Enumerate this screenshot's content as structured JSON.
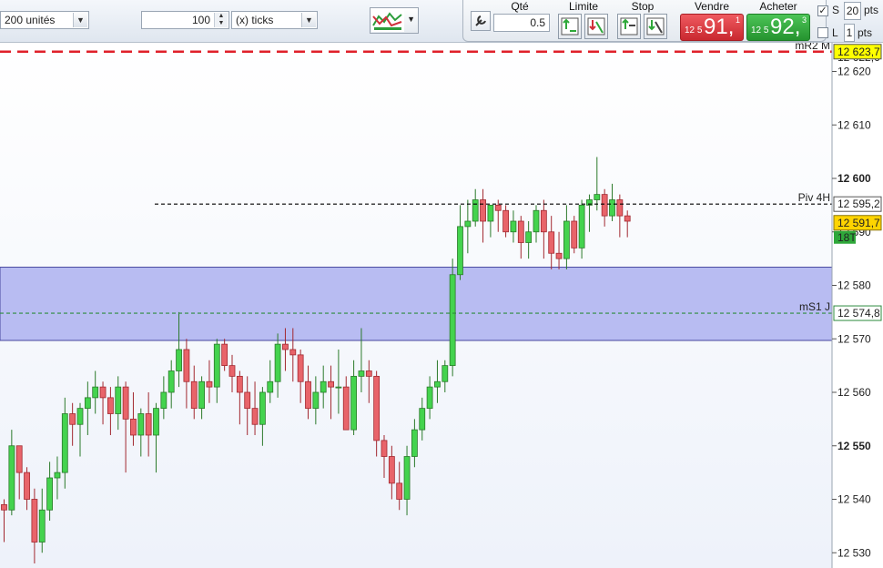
{
  "toolbar": {
    "units_select": "200 unités",
    "ticks_value": "100",
    "ticks_unit": "(x) ticks",
    "qty_label": "Qté",
    "qty_value": "0.5",
    "limit_label": "Limite",
    "stop_label": "Stop",
    "sell_label": "Vendre",
    "buy_label": "Acheter",
    "sell_price_prefix": "12 5",
    "sell_price_main": "91,",
    "sell_price_sup": "1",
    "buy_price_prefix": "12 5",
    "buy_price_main": "92,",
    "buy_price_sup": "3",
    "stop_s_label": "S",
    "stop_s_value": "20",
    "stop_s_unit": "pts",
    "limit_l_label": "L",
    "limit_l_value": "1",
    "limit_l_unit": "pts",
    "sell_color": "#e0444c",
    "buy_color": "#2fa83a"
  },
  "chart_data": {
    "type": "candlestick",
    "ylim": [
      12528,
      12624
    ],
    "y_ticks": [
      "12 530",
      "12 540",
      "12 550",
      "12 560",
      "12 570",
      "12 580",
      "12 590",
      "12 600",
      "12 610",
      "12 620"
    ],
    "zone": {
      "low": 12569.7,
      "high": 12583.4,
      "color": "#b8bcf2"
    },
    "lines": [
      {
        "name": "mR2 M",
        "value": 12623.7,
        "label": "12 623,7",
        "color": "#e0202a",
        "style": "dashed"
      },
      {
        "name": "Piv 4H",
        "value": 12595.2,
        "label": "12 595,2",
        "color": "#000000",
        "style": "dotted"
      },
      {
        "name": "mS1 J",
        "value": 12574.8,
        "label": "12 574,8",
        "color": "#2e8b3e",
        "style": "dashed"
      }
    ],
    "hidden_label": "12 622,6",
    "current_price": {
      "value": 12591.7,
      "label": "12 591,7"
    },
    "timer_label": "18T",
    "candles": [
      [
        12539,
        12540,
        12532,
        12538
      ],
      [
        12538,
        12553,
        12537,
        12550
      ],
      [
        12550,
        12549,
        12540,
        12545
      ],
      [
        12545,
        12546,
        12538,
        12540
      ],
      [
        12540,
        12542,
        12528,
        12532
      ],
      [
        12532,
        12542,
        12530,
        12538
      ],
      [
        12538,
        12547,
        12536,
        12544
      ],
      [
        12544,
        12548,
        12540,
        12545
      ],
      [
        12545,
        12559,
        12542,
        12556
      ],
      [
        12556,
        12558,
        12550,
        12554
      ],
      [
        12554,
        12558,
        12548,
        12557
      ],
      [
        12557,
        12562,
        12552,
        12559
      ],
      [
        12559,
        12564,
        12556,
        12561
      ],
      [
        12561,
        12562,
        12554,
        12559
      ],
      [
        12559,
        12561,
        12552,
        12556
      ],
      [
        12556,
        12563,
        12553,
        12561
      ],
      [
        12561,
        12562,
        12545,
        12555
      ],
      [
        12555,
        12560,
        12550,
        12552
      ],
      [
        12552,
        12557,
        12548,
        12556
      ],
      [
        12556,
        12560,
        12548,
        12552
      ],
      [
        12552,
        12558,
        12545,
        12557
      ],
      [
        12557,
        12563,
        12555,
        12560
      ],
      [
        12560,
        12566,
        12557,
        12564
      ],
      [
        12564,
        12575,
        12561,
        12568
      ],
      [
        12568,
        12570,
        12557,
        12562
      ],
      [
        12562,
        12565,
        12555,
        12557
      ],
      [
        12557,
        12563,
        12555,
        12562
      ],
      [
        12562,
        12566,
        12558,
        12561
      ],
      [
        12561,
        12570,
        12558,
        12569
      ],
      [
        12569,
        12570,
        12564,
        12565
      ],
      [
        12565,
        12567,
        12560,
        12563
      ],
      [
        12563,
        12564,
        12554,
        12560
      ],
      [
        12560,
        12563,
        12552,
        12557
      ],
      [
        12557,
        12562,
        12552,
        12554
      ],
      [
        12554,
        12561,
        12550,
        12560
      ],
      [
        12560,
        12566,
        12558,
        12562
      ],
      [
        12562,
        12571,
        12559,
        12569
      ],
      [
        12569,
        12572,
        12564,
        12568
      ],
      [
        12568,
        12572,
        12562,
        12567
      ],
      [
        12567,
        12568,
        12558,
        12562
      ],
      [
        12562,
        12565,
        12555,
        12557
      ],
      [
        12557,
        12563,
        12554,
        12560
      ],
      [
        12560,
        12565,
        12557,
        12562
      ],
      [
        12562,
        12565,
        12555,
        12561
      ],
      [
        12561,
        12568,
        12556,
        12561
      ],
      [
        12561,
        12563,
        12553,
        12553
      ],
      [
        12553,
        12566,
        12552,
        12563
      ],
      [
        12563,
        12572,
        12560,
        12564
      ],
      [
        12564,
        12566,
        12558,
        12563
      ],
      [
        12563,
        12564,
        12548,
        12551
      ],
      [
        12551,
        12552,
        12544,
        12548
      ],
      [
        12548,
        12550,
        12540,
        12543
      ],
      [
        12543,
        12547,
        12538,
        12540
      ],
      [
        12540,
        12550,
        12537,
        12548
      ],
      [
        12548,
        12555,
        12546,
        12553
      ],
      [
        12553,
        12559,
        12551,
        12557
      ],
      [
        12557,
        12563,
        12555,
        12561
      ],
      [
        12561,
        12566,
        12558,
        12562
      ],
      [
        12562,
        12566,
        12560,
        12565
      ],
      [
        12565,
        12585,
        12563,
        12582
      ],
      [
        12582,
        12595,
        12581,
        12591
      ],
      [
        12591,
        12596,
        12586,
        12592
      ],
      [
        12592,
        12598,
        12591,
        12596
      ],
      [
        12596,
        12598,
        12588,
        12592
      ],
      [
        12592,
        12595,
        12589,
        12595
      ],
      [
        12595,
        12596,
        12590,
        12594
      ],
      [
        12594,
        12595,
        12589,
        12590
      ],
      [
        12590,
        12594,
        12588,
        12592
      ],
      [
        12592,
        12593,
        12585,
        12588
      ],
      [
        12588,
        12592,
        12585,
        12590
      ],
      [
        12590,
        12595,
        12588,
        12594
      ],
      [
        12594,
        12596,
        12585,
        12590
      ],
      [
        12590,
        12593,
        12583,
        12586
      ],
      [
        12586,
        12590,
        12583,
        12585
      ],
      [
        12585,
        12595,
        12583,
        12592
      ],
      [
        12592,
        12593,
        12586,
        12587
      ],
      [
        12587,
        12596,
        12585,
        12595
      ],
      [
        12595,
        12597,
        12590,
        12596
      ],
      [
        12596,
        12604,
        12594,
        12597
      ],
      [
        12597,
        12598,
        12591,
        12593
      ],
      [
        12593,
        12599,
        12592,
        12596
      ],
      [
        12596,
        12597,
        12589,
        12593
      ],
      [
        12593,
        12594,
        12589,
        12592
      ]
    ]
  }
}
